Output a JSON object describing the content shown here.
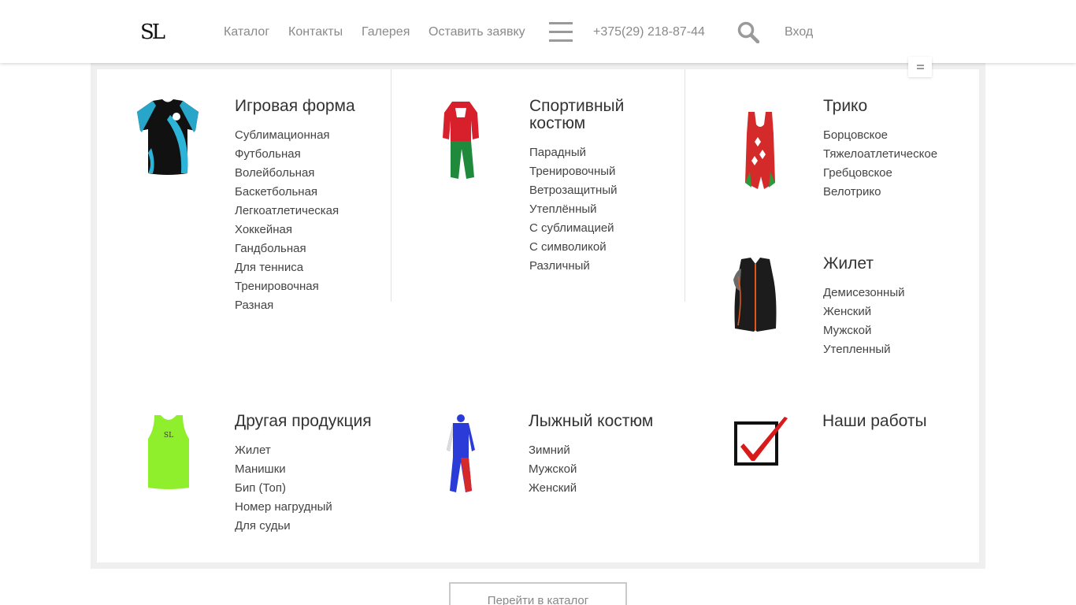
{
  "header": {
    "logo_text": "SL",
    "nav": [
      "Каталог",
      "Контакты",
      "Галерея",
      "Оставить заявку"
    ],
    "phone": "+375(29) 218-87-44",
    "login": "Вход"
  },
  "catalog": {
    "sections": [
      {
        "title": "Игровая форма",
        "items": [
          "Сублимационная",
          "Футбольная",
          "Волейбольная",
          "Баскетбольная",
          "Легкоатлетическая",
          "Хоккейная",
          "Гандбольная",
          "Для тенниса",
          "Тренировочная",
          "Разная"
        ]
      },
      {
        "title": "Спортивный костюм",
        "items": [
          "Парадный",
          "Тренировочный",
          "Ветрозащитный",
          "Утеплённый",
          "С сублимацией",
          "С символикой",
          "Различный"
        ]
      },
      {
        "title": "Трико",
        "items": [
          "Борцовское",
          "Тяжелоатлетическое",
          "Гребцовское",
          "Велотрико"
        ]
      },
      {
        "title": "Жилет",
        "items": [
          "Демисезонный",
          "Женский",
          "Мужской",
          "Утепленный"
        ]
      },
      {
        "title": "Другая продукция",
        "items": [
          "Жилет",
          "Манишки",
          "Бип (Топ)",
          "Номер нагрудный",
          "Для судьи"
        ]
      },
      {
        "title": "Лыжный костюм",
        "items": [
          "Зимний",
          "Мужской",
          "Женский"
        ]
      },
      {
        "title": "Наши работы",
        "items": []
      }
    ],
    "cta_button": "Перейти в каталог"
  },
  "colors": {
    "nav_text": "#8a8a8a",
    "title_text": "#333333",
    "frame_bg": "#efefef",
    "divider": "#e2e2e2"
  }
}
